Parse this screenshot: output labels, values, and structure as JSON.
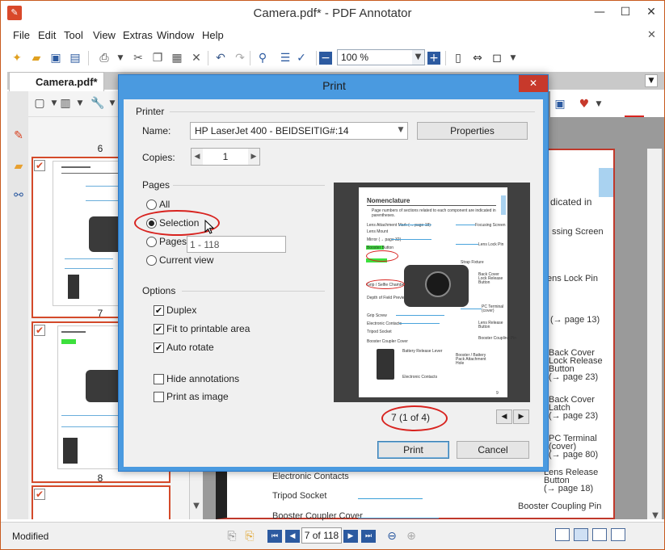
{
  "window": {
    "title": "Camera.pdf* - PDF Annotator",
    "minimize": "—",
    "maximize": "☐",
    "close": "✕"
  },
  "menu": [
    "File",
    "Edit",
    "Tool",
    "View",
    "Extras",
    "Window",
    "Help"
  ],
  "toolbar": {
    "zoom": "100 %"
  },
  "doc_tab": {
    "label": "Camera.pdf*"
  },
  "thumbnails": {
    "pages": [
      "6",
      "7",
      "8"
    ]
  },
  "document": {
    "texts": [
      "dicated in",
      "ssing Screen",
      "ens Lock Pin",
      "(→ page 13)",
      "Back Cover",
      "Lock Release",
      "Button",
      "(→ page 23)",
      "Back Cover",
      "Latch",
      "(→ page 23)",
      "PC Terminal",
      "(cover)",
      "(→ page 80)",
      "Lens Release",
      "Button",
      "(→ page 18)",
      "Booster Coupling Pin",
      "Electronic Contacts",
      "Tripod Socket",
      "Booster Coupler Cover"
    ]
  },
  "statusbar": {
    "status": "Modified",
    "page_indicator": "7 of 118"
  },
  "dialog": {
    "title": "Print",
    "close_label": "✕",
    "printer": {
      "group_label": "Printer",
      "name_label": "Name:",
      "name_value": "HP LaserJet 400 - BEIDSEITIG#:14",
      "properties_label": "Properties",
      "copies_label": "Copies:",
      "copies_value": "1"
    },
    "pages": {
      "group_label": "Pages",
      "options": [
        "All",
        "Selection",
        "Pages",
        "Current view"
      ],
      "selected": "Selection",
      "range_value": "1 - 118"
    },
    "options": {
      "group_label": "Options",
      "items": [
        {
          "label": "Duplex",
          "checked": true
        },
        {
          "label": "Fit to printable area",
          "checked": true
        },
        {
          "label": "Auto rotate",
          "checked": true
        },
        {
          "label": "Hide annotations",
          "checked": false
        },
        {
          "label": "Print as image",
          "checked": false
        }
      ]
    },
    "preview": {
      "title": "Nomenclature",
      "intro": "Page numbers of sections related to each component are indicated in parentheses.",
      "labels": [
        "Lens Attachment Mark (→ page 18)",
        "Lens Mount",
        "Mirror (→ page 32)",
        "Booster Button",
        "Grip / Selfie Chamber",
        "Depth of Field Preview Button",
        "Grip Screw",
        "Electronic Contacts",
        "Tripod Socket",
        "Booster Coupler Cover",
        "Battery Release Lever",
        "Electronic Contacts",
        "Focusing Screen",
        "Lens Lock Pin",
        "Strap Fixture",
        "Back Cover Lock Release Button",
        "PC Terminal (cover)",
        "Lens Release Button",
        "Booster Coupling Pin",
        "Booster / Battery Pack Attachment Hole"
      ],
      "page_no": "9",
      "counter": "7 (1 of 4)"
    },
    "print_label": "Print",
    "cancel_label": "Cancel"
  }
}
